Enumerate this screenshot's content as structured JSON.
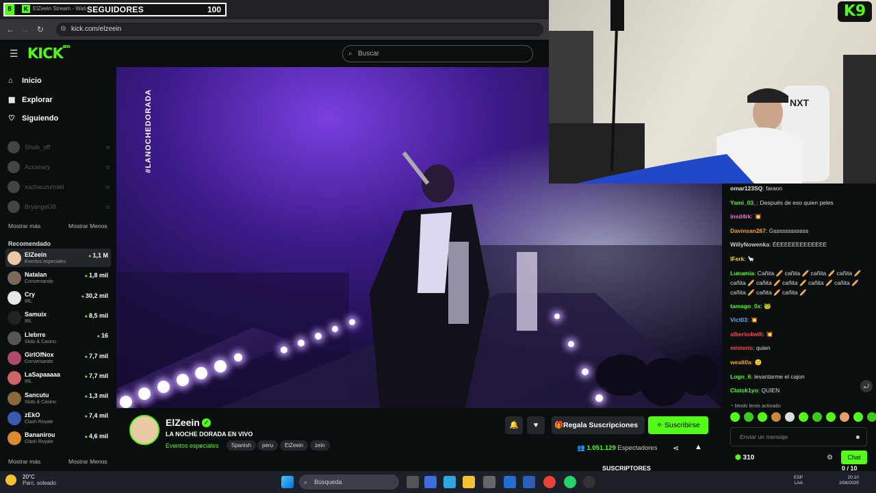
{
  "counter": {
    "label": "SEGUIDORES",
    "value": "100"
  },
  "browser": {
    "tab_number": "8",
    "tab_title": "ElZeein Stream - Watch",
    "url": "kick.com/elzeein"
  },
  "header": {
    "logo": "KICK",
    "logo_sup": "BETA",
    "search_placeholder": "Buscar"
  },
  "sidebar": {
    "nav": [
      {
        "label": "Inicio",
        "icon": "home-icon"
      },
      {
        "label": "Explorar",
        "icon": "compass-icon"
      },
      {
        "label": "Siguiendo",
        "icon": "heart-icon"
      }
    ],
    "following": [
      "Shuls_off",
      "Accanary",
      "xachauzumaki",
      "Bryangel38"
    ],
    "show_more": "Mostrar más",
    "show_less": "Mostrar Menos",
    "recommended_title": "Recomendado",
    "recommended": [
      {
        "name": "ElZeein",
        "category": "Eventos especiales",
        "viewers": "1,1 M",
        "color": "#e9c9a6"
      },
      {
        "name": "Natalan",
        "category": "Conversando",
        "viewers": "1,8 mil",
        "color": "#7a6a5a"
      },
      {
        "name": "Cry",
        "category": "IRL",
        "viewers": "30,2 mil",
        "color": "#e8e8e8"
      },
      {
        "name": "Samuix",
        "category": "IRL",
        "viewers": "8,5 mil",
        "color": "#222"
      },
      {
        "name": "Llebrre",
        "category": "Slots & Casino",
        "viewers": "16",
        "color": "#555"
      },
      {
        "name": "GirlOfNox",
        "category": "Conversando",
        "viewers": "7,7 mil",
        "color": "#b04a6a"
      },
      {
        "name": "LaSapaaaaa",
        "category": "IRL",
        "viewers": "7,7 mil",
        "color": "#c66"
      },
      {
        "name": "Sancutu",
        "category": "Slots & Casino",
        "viewers": "1,3 mil",
        "color": "#8a6a3a"
      },
      {
        "name": "zEkO",
        "category": "Clash Royale",
        "viewers": "7,4 mil",
        "color": "#3a5ab0"
      },
      {
        "name": "Bananirou",
        "category": "Clash Royale",
        "viewers": "4,6 mil",
        "color": "#d83"
      }
    ]
  },
  "video": {
    "hashtag": "#LANOCHEDORADA"
  },
  "stream": {
    "streamer": "ElZeein",
    "title": "LA NOCHE DORADA EN VIVO",
    "category": "Eventos especiales",
    "tags": [
      "Spanish",
      "peru",
      "ElZeein",
      "zein"
    ],
    "gift_label": "Regala Suscripciones",
    "subscribe_label": "Suscribirse",
    "viewers_count": "1.051.129",
    "viewers_label": "Espectadores",
    "subs_label": "SUSCRIPTORES"
  },
  "chat": {
    "messages": [
      {
        "user": "omar123SQ",
        "color": "#e8e8e8",
        "text": "faraon"
      },
      {
        "user": "Yami_03_",
        "color": "#53fc18",
        "text": "Después de eso quien peles"
      },
      {
        "user": "insd4rk",
        "color": "#ff6ad5",
        "text": "💥"
      },
      {
        "user": "Davinsan267",
        "color": "#f5a623",
        "text": "Gssssssssssss"
      },
      {
        "user": "WillyNowenka",
        "color": "#cfcfcf",
        "text": "ÉEEEEEEEEEEEEE"
      },
      {
        "user": "IFerk",
        "color": "#f5d623",
        "text": "🦙"
      },
      {
        "user": "Lunamia",
        "color": "#53fc18",
        "text": "Cañita 🥖 cañita 🥖 cañita 🥖 cañita 🥖 cañita 🥖 cañita 🥖 cañita 🥖 cañita 🥖 cañita 🥖 cañita 🥖 cañita 🥖 cañita 🥖"
      },
      {
        "user": "tamago_0x",
        "color": "#53fc18",
        "text": "🐸"
      },
      {
        "user": "Vict03",
        "color": "#6aa7ff",
        "text": "💥"
      },
      {
        "user": "alberto4wifi",
        "color": "#ff4a4a",
        "text": "💥"
      },
      {
        "user": "misterio",
        "color": "#ff4a4a",
        "text": "quien"
      },
      {
        "user": "wealt0a",
        "color": "#f5a623",
        "text": "🙂"
      },
      {
        "user": "Logn_6",
        "color": "#53fc18",
        "text": "levantarme el cajon"
      },
      {
        "user": "Clatok1yo",
        "color": "#53fc18",
        "text": "QUIEN"
      }
    ],
    "slow_mode": "Modo lento activado",
    "input_placeholder": "Enviar un mensaje",
    "points": "310",
    "chat_button": "Chat",
    "goal": "0 / 10"
  },
  "taskbar": {
    "temp": "20°C",
    "weather": "Parc. soleado",
    "search": "Búsqueda",
    "lang1": "ESP",
    "lang2": "LAA",
    "time": "20:10",
    "date": "2/08/2025"
  },
  "colors": {
    "accent": "#53fc18",
    "bg": "#0b0e0f",
    "panel": "#24272c"
  }
}
